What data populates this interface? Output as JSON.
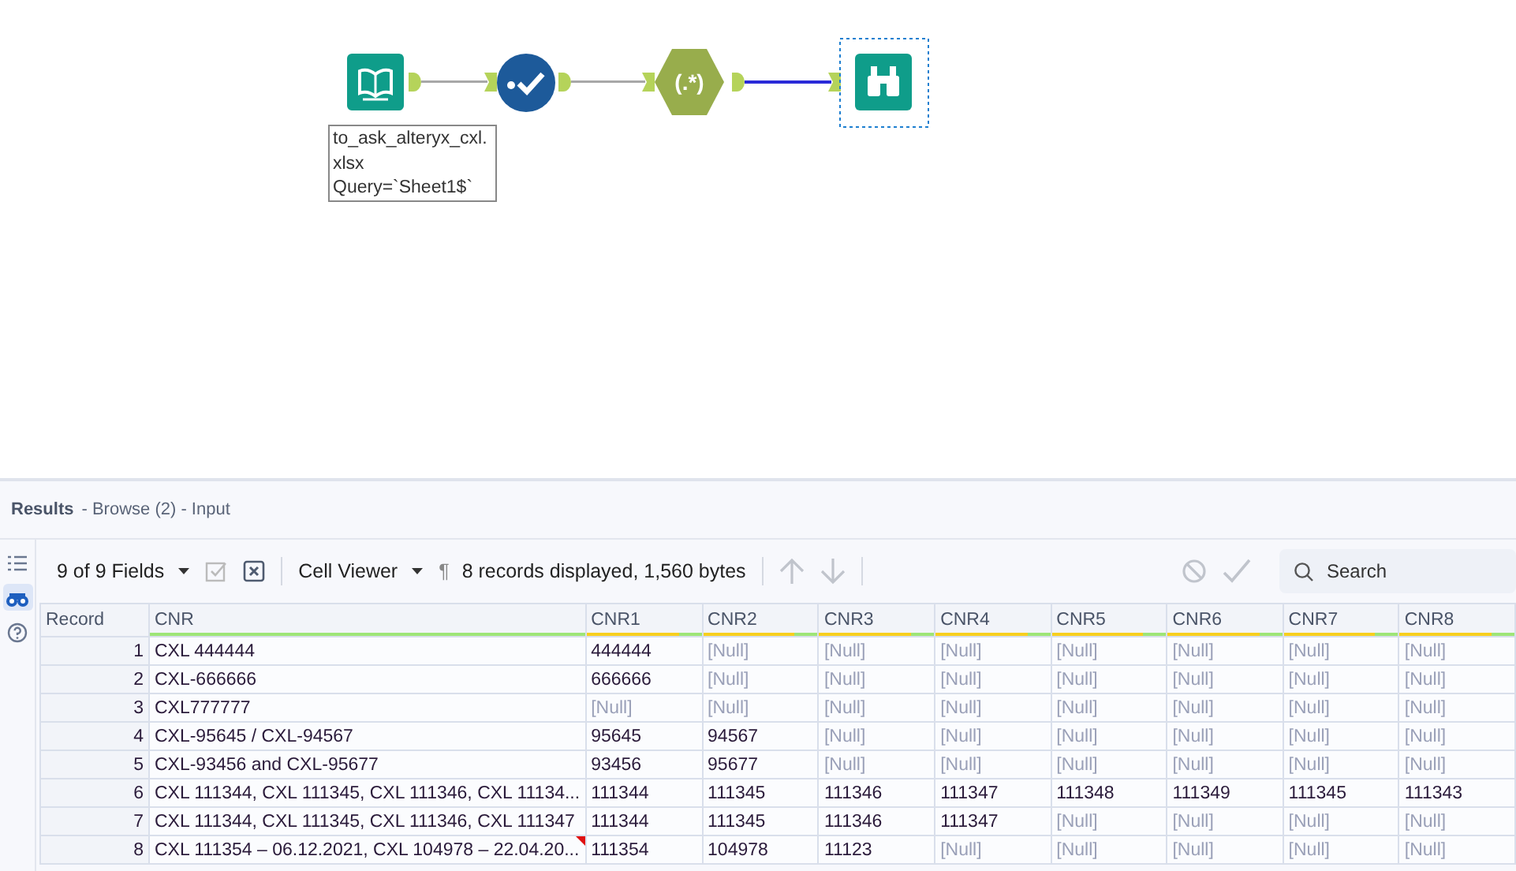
{
  "workflow": {
    "nodes": [
      {
        "kind": "input",
        "selected": false
      },
      {
        "kind": "select",
        "selected": false
      },
      {
        "kind": "regex",
        "glyph": "(.*)",
        "selected": false
      },
      {
        "kind": "browse",
        "selected": true
      }
    ],
    "connections": [
      {
        "highlighted": false
      },
      {
        "highlighted": false
      },
      {
        "highlighted": true
      }
    ],
    "annotation_lines": [
      "to_ask_alteryx_cxl.",
      "xlsx",
      "Query=`Sheet1$`"
    ]
  },
  "results": {
    "title": "Results",
    "subtitle": "- Browse (2) - Input",
    "rail": [
      {
        "kind": "list",
        "selected": false
      },
      {
        "kind": "browse",
        "selected": true
      },
      {
        "kind": "help",
        "selected": false
      }
    ],
    "toolbar": {
      "fields": "9 of 9 Fields",
      "viewer": "Cell Viewer",
      "pilcrow": "¶",
      "summary": "8 records displayed, 1,560 bytes",
      "search_placeholder": "Search"
    },
    "table": {
      "columns": [
        {
          "label": "Record",
          "kind": "record"
        },
        {
          "label": "CNR",
          "kind": "string"
        },
        {
          "label": "CNR1",
          "kind": "number"
        },
        {
          "label": "CNR2",
          "kind": "number"
        },
        {
          "label": "CNR3",
          "kind": "number"
        },
        {
          "label": "CNR4",
          "kind": "number"
        },
        {
          "label": "CNR5",
          "kind": "number"
        },
        {
          "label": "CNR6",
          "kind": "number"
        },
        {
          "label": "CNR7",
          "kind": "number"
        },
        {
          "label": "CNR8",
          "kind": "number"
        }
      ],
      "rows": [
        {
          "cnr_marked": false,
          "cells": [
            "1",
            "CXL 444444",
            "444444",
            "[Null]",
            "[Null]",
            "[Null]",
            "[Null]",
            "[Null]",
            "[Null]",
            "[Null]"
          ],
          "nulls": [
            false,
            false,
            false,
            true,
            true,
            true,
            true,
            true,
            true,
            true
          ]
        },
        {
          "cnr_marked": false,
          "cells": [
            "2",
            "CXL-666666",
            "666666",
            "[Null]",
            "[Null]",
            "[Null]",
            "[Null]",
            "[Null]",
            "[Null]",
            "[Null]"
          ],
          "nulls": [
            false,
            false,
            false,
            true,
            true,
            true,
            true,
            true,
            true,
            true
          ]
        },
        {
          "cnr_marked": false,
          "cells": [
            "3",
            "CXL777777",
            "[Null]",
            "[Null]",
            "[Null]",
            "[Null]",
            "[Null]",
            "[Null]",
            "[Null]",
            "[Null]"
          ],
          "nulls": [
            false,
            false,
            true,
            true,
            true,
            true,
            true,
            true,
            true,
            true
          ]
        },
        {
          "cnr_marked": false,
          "cells": [
            "4",
            "CXL-95645 / CXL-94567",
            "95645",
            "94567",
            "[Null]",
            "[Null]",
            "[Null]",
            "[Null]",
            "[Null]",
            "[Null]"
          ],
          "nulls": [
            false,
            false,
            false,
            false,
            true,
            true,
            true,
            true,
            true,
            true
          ]
        },
        {
          "cnr_marked": false,
          "cells": [
            "5",
            "CXL-93456 and CXL-95677",
            "93456",
            "95677",
            "[Null]",
            "[Null]",
            "[Null]",
            "[Null]",
            "[Null]",
            "[Null]"
          ],
          "nulls": [
            false,
            false,
            false,
            false,
            true,
            true,
            true,
            true,
            true,
            true
          ]
        },
        {
          "cnr_marked": false,
          "cells": [
            "6",
            "CXL 111344, CXL 111345, CXL 111346, CXL 11134...",
            "111344",
            "111345",
            "111346",
            "111347",
            "111348",
            "111349",
            "111345",
            "111343"
          ],
          "nulls": [
            false,
            false,
            false,
            false,
            false,
            false,
            false,
            false,
            false,
            false
          ]
        },
        {
          "cnr_marked": false,
          "cells": [
            "7",
            "CXL 111344, CXL 111345, CXL 111346, CXL 111347",
            "111344",
            "111345",
            "111346",
            "111347",
            "[Null]",
            "[Null]",
            "[Null]",
            "[Null]"
          ],
          "nulls": [
            false,
            false,
            false,
            false,
            false,
            false,
            true,
            true,
            true,
            true
          ]
        },
        {
          "cnr_marked": true,
          "cells": [
            "8",
            "CXL 111354 – 06.12.2021, CXL 104978 – 22.04.20...",
            "111354",
            "104978",
            "11123",
            "[Null]",
            "[Null]",
            "[Null]",
            "[Null]",
            "[Null]"
          ],
          "nulls": [
            false,
            false,
            false,
            false,
            false,
            true,
            true,
            true,
            true,
            true
          ]
        }
      ]
    }
  }
}
